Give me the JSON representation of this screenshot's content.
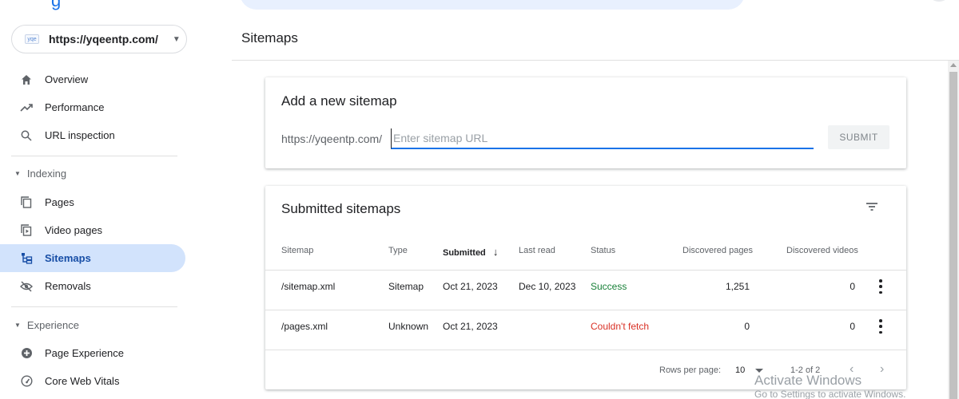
{
  "header": {
    "logo_fragment": "g"
  },
  "sidebar": {
    "property_url": "https://yqeentp.com/",
    "favicon_text": "yqe",
    "items": [
      {
        "label": "Overview",
        "icon": "home-icon"
      },
      {
        "label": "Performance",
        "icon": "trending-up-icon"
      },
      {
        "label": "URL inspection",
        "icon": "search-icon"
      }
    ],
    "indexing": {
      "header": "Indexing",
      "items": [
        {
          "label": "Pages",
          "icon": "pages-icon"
        },
        {
          "label": "Video pages",
          "icon": "video-pages-icon"
        },
        {
          "label": "Sitemaps",
          "icon": "sitemap-icon",
          "active": true
        },
        {
          "label": "Removals",
          "icon": "removals-icon"
        }
      ]
    },
    "experience": {
      "header": "Experience",
      "items": [
        {
          "label": "Page Experience",
          "icon": "page-experience-icon"
        },
        {
          "label": "Core Web Vitals",
          "icon": "gauge-icon"
        }
      ]
    }
  },
  "main": {
    "page_title": "Sitemaps",
    "add_sitemap": {
      "title": "Add a new sitemap",
      "prefix": "https://yqeentp.com/",
      "placeholder": "Enter sitemap URL",
      "value": "",
      "submit_label": "SUBMIT"
    },
    "submitted": {
      "title": "Submitted sitemaps",
      "columns": {
        "sitemap": "Sitemap",
        "type": "Type",
        "submitted": "Submitted",
        "last_read": "Last read",
        "status": "Status",
        "discovered_pages": "Discovered pages",
        "discovered_videos": "Discovered videos"
      },
      "sort_indicator": "↓",
      "rows": [
        {
          "sitemap": "/sitemap.xml",
          "type": "Sitemap",
          "submitted": "Oct 21, 2023",
          "last_read": "Dec 10, 2023",
          "status": "Success",
          "discovered_pages": "1,251",
          "discovered_videos": "0"
        },
        {
          "sitemap": "/pages.xml",
          "type": "Unknown",
          "submitted": "Oct 21, 2023",
          "last_read": "",
          "status": "Couldn't fetch",
          "discovered_pages": "0",
          "discovered_videos": "0"
        }
      ],
      "footer": {
        "rows_per_page_label": "Rows per page:",
        "rows_per_page_value": "10",
        "range": "1-2 of 2",
        "prev": "‹",
        "next": "›"
      }
    }
  },
  "watermark": {
    "line1": "Activate Windows",
    "line2": "Go to Settings to activate Windows."
  },
  "colors": {
    "accent": "#1a73e8",
    "active_nav_bg": "#d2e3fc",
    "success": "#188038",
    "error": "#d93025"
  }
}
